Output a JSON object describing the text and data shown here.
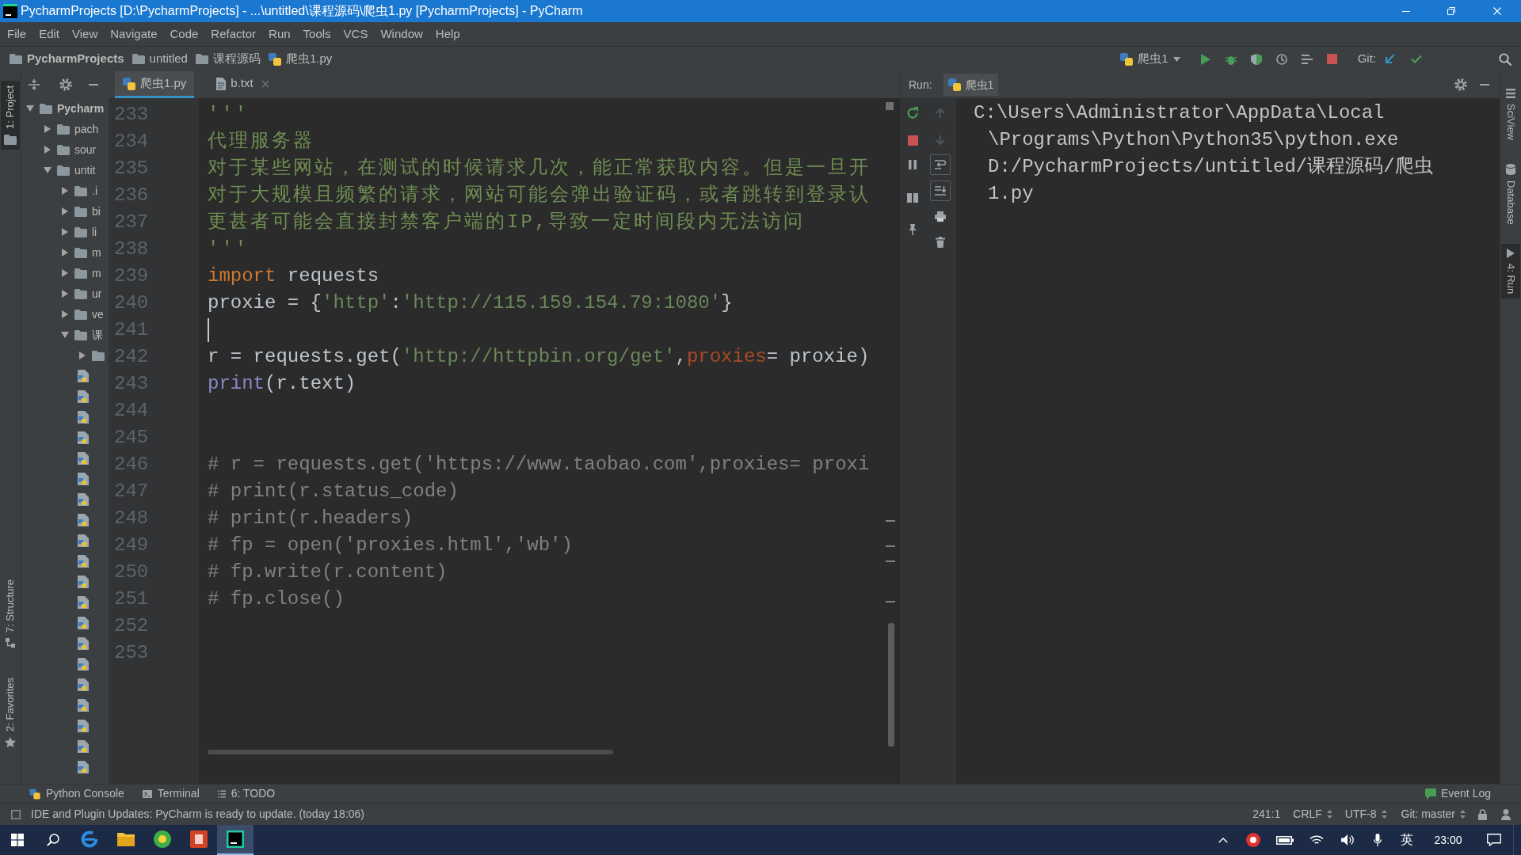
{
  "window": {
    "title": "PycharmProjects [D:\\PycharmProjects] - ...\\untitled\\课程源码\\爬虫1.py [PycharmProjects] - PyCharm"
  },
  "menu": [
    "File",
    "Edit",
    "View",
    "Navigate",
    "Code",
    "Refactor",
    "Run",
    "Tools",
    "VCS",
    "Window",
    "Help"
  ],
  "navigation_bar": {
    "breadcrumbs": [
      {
        "label": "PycharmProjects",
        "kind": "project"
      },
      {
        "label": "untitled",
        "kind": "folder"
      },
      {
        "label": "课程源码",
        "kind": "folder"
      },
      {
        "label": "爬虫1.py",
        "kind": "python-file"
      }
    ],
    "run_configuration": "爬虫1",
    "vcs_label": "Git:"
  },
  "left_tool_strip": [
    {
      "label": "1: Project",
      "kind": "project",
      "selected": true
    },
    {
      "label": "7: Structure",
      "kind": "structure",
      "selected": false
    },
    {
      "label": "2: Favorites",
      "kind": "favorites",
      "selected": false
    }
  ],
  "project_tree": [
    {
      "label": "Pycharm",
      "kind": "project-folder",
      "expanded": true,
      "children": [
        {
          "label": "pach",
          "kind": "folder",
          "expanded": false
        },
        {
          "label": "sour",
          "kind": "folder",
          "expanded": false
        },
        {
          "label": "untit",
          "kind": "folder",
          "expanded": true,
          "children": [
            {
              "label": ".i",
              "kind": "folder",
              "expanded": false
            },
            {
              "label": "bi",
              "kind": "folder",
              "expanded": false
            },
            {
              "label": "li",
              "kind": "folder",
              "expanded": false
            },
            {
              "label": "m",
              "kind": "folder",
              "expanded": false
            },
            {
              "label": "m",
              "kind": "folder",
              "expanded": false
            },
            {
              "label": "ur",
              "kind": "folder",
              "expanded": false
            },
            {
              "label": "ve",
              "kind": "folder",
              "expanded": false
            },
            {
              "label": "课",
              "kind": "folder",
              "expanded": true,
              "children": [
                {
                  "kind": "folder",
                  "expanded": false
                },
                {
                  "kind": "python-file"
                },
                {
                  "kind": "python-file"
                },
                {
                  "kind": "python-file"
                },
                {
                  "kind": "python-file"
                },
                {
                  "kind": "python-file"
                },
                {
                  "kind": "python-file"
                },
                {
                  "kind": "python-file"
                },
                {
                  "kind": "python-file"
                },
                {
                  "kind": "python-file"
                },
                {
                  "kind": "python-file"
                },
                {
                  "kind": "python-file"
                },
                {
                  "kind": "python-file"
                },
                {
                  "kind": "python-file"
                },
                {
                  "kind": "python-file"
                },
                {
                  "kind": "python-file"
                },
                {
                  "kind": "python-file"
                },
                {
                  "kind": "python-file"
                },
                {
                  "kind": "python-file"
                },
                {
                  "kind": "python-file"
                },
                {
                  "kind": "python-file"
                }
              ]
            }
          ]
        }
      ]
    }
  ],
  "editor": {
    "tabs": [
      {
        "label": "爬虫1.py",
        "kind": "python-file",
        "selected": true
      },
      {
        "label": "b.txt",
        "kind": "text-file",
        "selected": false
      }
    ],
    "lines": [
      {
        "number": "233",
        "caret": false,
        "tokens": [
          {
            "kind": "docstring",
            "text": "'''"
          }
        ]
      },
      {
        "number": "234",
        "caret": false,
        "tokens": [
          {
            "kind": "docstring",
            "text": "代理服务器"
          }
        ]
      },
      {
        "number": "235",
        "caret": false,
        "tokens": [
          {
            "kind": "docstring",
            "text": "对于某些网站，在测试的时候请求几次，能正常获取内容。但是一旦开"
          }
        ]
      },
      {
        "number": "236",
        "caret": false,
        "tokens": [
          {
            "kind": "docstring",
            "text": "对于大规模且频繁的请求，网站可能会弹出验证码，或者跳转到登录认"
          }
        ]
      },
      {
        "number": "237",
        "caret": false,
        "tokens": [
          {
            "kind": "docstring",
            "text": "更甚者可能会直接封禁客户端的IP,导致一定时间段内无法访问"
          }
        ]
      },
      {
        "number": "238",
        "caret": false,
        "tokens": [
          {
            "kind": "docstring",
            "text": "'''"
          }
        ]
      },
      {
        "number": "239",
        "caret": false,
        "tokens": [
          {
            "kind": "keyword",
            "text": "import"
          },
          {
            "kind": "plain",
            "text": " requests"
          }
        ]
      },
      {
        "number": "240",
        "caret": false,
        "tokens": [
          {
            "kind": "plain",
            "text": "proxie = {"
          },
          {
            "kind": "string",
            "text": "'http'"
          },
          {
            "kind": "plain",
            "text": ":"
          },
          {
            "kind": "string",
            "text": "'http://115.159.154.79:1080'"
          },
          {
            "kind": "plain",
            "text": "}"
          }
        ]
      },
      {
        "number": "241",
        "caret": true
      },
      {
        "number": "242",
        "caret": false,
        "tokens": [
          {
            "kind": "plain",
            "text": "r = requests.get("
          },
          {
            "kind": "string",
            "text": "'http://httpbin.org/get'"
          },
          {
            "kind": "plain",
            "text": ","
          },
          {
            "kind": "param",
            "text": "proxies"
          },
          {
            "kind": "plain",
            "text": "= proxie)"
          }
        ]
      },
      {
        "number": "243",
        "caret": false,
        "tokens": [
          {
            "kind": "builtin",
            "text": "print"
          },
          {
            "kind": "plain",
            "text": "(r.text)"
          }
        ]
      },
      {
        "number": "244",
        "caret": false
      },
      {
        "number": "245",
        "caret": false
      },
      {
        "number": "246",
        "caret": false,
        "tokens": [
          {
            "kind": "comment",
            "text": "# r = requests.get('https://www.taobao.com',proxies= proxi"
          }
        ]
      },
      {
        "number": "247",
        "caret": false,
        "tokens": [
          {
            "kind": "comment",
            "text": "# print(r.status_code)"
          }
        ]
      },
      {
        "number": "248",
        "caret": false,
        "tokens": [
          {
            "kind": "comment",
            "text": "# print(r.headers)"
          }
        ]
      },
      {
        "number": "249",
        "caret": false,
        "tokens": [
          {
            "kind": "comment",
            "text": "# fp = open('proxies.html','wb')"
          }
        ]
      },
      {
        "number": "250",
        "caret": false,
        "tokens": [
          {
            "kind": "comment",
            "text": "# fp.write(r.content)"
          }
        ]
      },
      {
        "number": "251",
        "caret": false,
        "tokens": [
          {
            "kind": "comment",
            "text": "# fp.close()"
          }
        ]
      },
      {
        "number": "252",
        "caret": false
      },
      {
        "number": "253",
        "caret": false
      }
    ]
  },
  "run_panel": {
    "title": "Run:",
    "tab": "爬虫1",
    "output_lines": [
      "C:\\Users\\Administrator\\AppData\\Local",
      "\\Programs\\Python\\Python35\\python.exe",
      "D:/PycharmProjects/untitled/课程源码/爬虫",
      "1.py"
    ]
  },
  "right_tool_strip": [
    {
      "label": "SciView",
      "kind": "sciview",
      "selected": false
    },
    {
      "label": "Database",
      "kind": "database",
      "selected": false
    },
    {
      "label": "4: Run",
      "kind": "run",
      "selected": true
    }
  ],
  "tool_window_bar": {
    "buttons": [
      {
        "label": "Python Console",
        "kind": "python-console"
      },
      {
        "label": "Terminal",
        "kind": "terminal"
      },
      {
        "label": "6: TODO",
        "kind": "todo"
      }
    ],
    "event_log": "Event Log"
  },
  "status_bar": {
    "message": "IDE and Plugin Updates: PyCharm is ready to update. (today 18:06)",
    "caret_position": "241:1",
    "line_separator": "CRLF",
    "encoding": "UTF-8",
    "vcs_branch": "Git: master"
  },
  "taskbar": {
    "apps": [
      {
        "kind": "browser",
        "selected": false
      },
      {
        "kind": "file-explorer",
        "selected": false
      },
      {
        "kind": "globe",
        "selected": false
      },
      {
        "kind": "presentation",
        "selected": false
      },
      {
        "kind": "ide",
        "selected": true
      }
    ],
    "input_method": "英",
    "clock": "23:00"
  }
}
